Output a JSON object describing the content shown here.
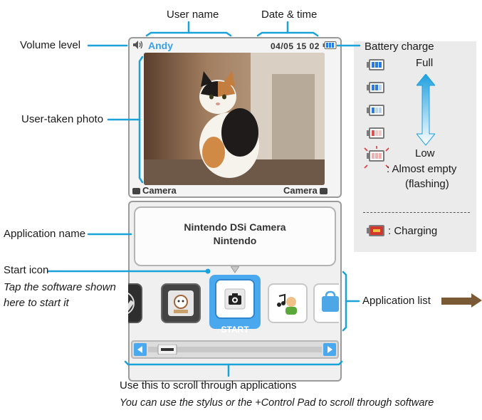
{
  "labels": {
    "user_name": "User name",
    "date_time": "Date & time",
    "volume_level": "Volume level",
    "battery_charge": "Battery charge",
    "user_taken_photo": "User-taken photo",
    "application_name": "Application name",
    "start_icon": "Start icon",
    "start_icon_note_1": "Tap the software shown",
    "start_icon_note_2": "here to start it",
    "application_list": "Application list",
    "scroll_title": "Use this to scroll through applications",
    "scroll_note": "You can use the stylus or the +Control Pad to scroll through software"
  },
  "top_screen": {
    "user": "Andy",
    "datetime": "04/05 15 02",
    "camera_left": "Camera",
    "camera_right": "Camera"
  },
  "bottom_screen": {
    "app_name": "Nintendo DSi Camera",
    "publisher": "Nintendo",
    "start_label": "START"
  },
  "legend": {
    "full": "Full",
    "low": "Low",
    "almost_empty_1": ": Almost empty",
    "almost_empty_2": "(flashing)",
    "charging": ": Charging"
  },
  "colors": {
    "leader": "#1aa3d9",
    "accent_blue": "#3aa0e8",
    "battery_blue": "#2a7de0",
    "battery_red": "#e05050",
    "arrow_brown": "#7a5a35"
  },
  "icons": [
    "volume-icon",
    "battery-icon",
    "camera-icon",
    "settings-wrench-icon",
    "flipnote-icon",
    "music-icon",
    "shop-icon",
    "scroll-left-icon",
    "scroll-right-icon",
    "battery-arrow-icon"
  ]
}
